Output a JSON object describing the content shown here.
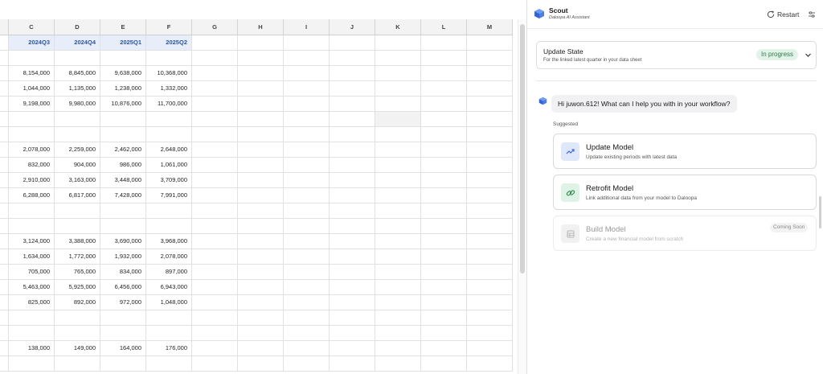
{
  "sheet": {
    "columns": [
      "C",
      "D",
      "E",
      "F",
      "G",
      "H",
      "I",
      "J",
      "K",
      "L",
      "M"
    ],
    "quarters": [
      "2024Q3",
      "2024Q4",
      "2025Q1",
      "2025Q2"
    ],
    "rows": [
      [],
      [
        "8,154,000",
        "8,845,000",
        "9,638,000",
        "10,368,000"
      ],
      [
        "1,044,000",
        "1,135,000",
        "1,238,000",
        "1,332,000"
      ],
      [
        "9,198,000",
        "9,980,000",
        "10,876,000",
        "11,700,000"
      ],
      [],
      [],
      [
        "2,078,000",
        "2,259,000",
        "2,462,000",
        "2,648,000"
      ],
      [
        "832,000",
        "904,000",
        "986,000",
        "1,061,000"
      ],
      [
        "2,910,000",
        "3,163,000",
        "3,448,000",
        "3,709,000"
      ],
      [
        "6,288,000",
        "6,817,000",
        "7,428,000",
        "7,991,000"
      ],
      [],
      [],
      [
        "3,124,000",
        "3,388,000",
        "3,690,000",
        "3,968,000"
      ],
      [
        "1,634,000",
        "1,772,000",
        "1,932,000",
        "2,078,000"
      ],
      [
        "705,000",
        "765,000",
        "834,000",
        "897,000"
      ],
      [
        "5,463,000",
        "5,925,000",
        "6,456,000",
        "6,943,000"
      ],
      [
        "825,000",
        "892,000",
        "972,000",
        "1,048,000"
      ],
      [],
      [],
      [
        "138,000",
        "149,000",
        "164,000",
        "176,000"
      ],
      []
    ]
  },
  "header": {
    "app_name": "Scout",
    "app_subtitle": "Daloopa AI Assistant",
    "restart_label": "Restart",
    "logo_icon": "daloopa-cube-icon",
    "settings_icon": "sliders-icon"
  },
  "update_state": {
    "title": "Update State",
    "subtitle": "For the linked latest quarter in your data sheet",
    "status": "In progress"
  },
  "chat": {
    "greeting": "Hi juwon.612! What can I help you with in your workflow?",
    "suggested_label": "Suggested"
  },
  "actions": [
    {
      "title": "Update Model",
      "subtitle": "Update existing periods with latest data",
      "icon": "trend-up-icon"
    },
    {
      "title": "Retrofit Model",
      "subtitle": "Link additional data from your model to Daloopa",
      "icon": "link-icon"
    },
    {
      "title": "Build Model",
      "subtitle": "Create a new financial model from scratch",
      "icon": "table-icon",
      "badge": "Coming Soon"
    }
  ],
  "colors": {
    "accent_blue": "#2c55a6",
    "status_green": "#2b7a45",
    "status_green_bg": "#e4f3e9"
  }
}
